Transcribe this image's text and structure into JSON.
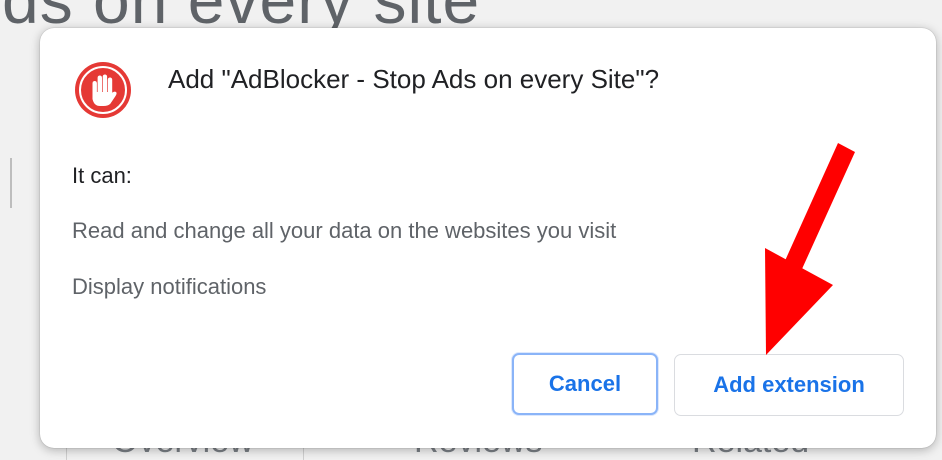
{
  "background": {
    "heading_fragment": "ds on every site",
    "tabs": [
      "Overview",
      "Reviews",
      "Related"
    ]
  },
  "dialog": {
    "icon": "adblocker-hand-icon",
    "icon_color": "#e53935",
    "title": "Add \"AdBlocker - Stop Ads on every Site\"?",
    "permissions_intro": "It can:",
    "permissions": [
      "Read and change all your data on the websites you visit",
      "Display notifications"
    ],
    "cancel_label": "Cancel",
    "add_label": "Add extension"
  },
  "annotation": {
    "type": "arrow",
    "color": "#ff0000",
    "points_to": "add-extension-button"
  },
  "colors": {
    "accent": "#1a73e8",
    "title_text": "#202124",
    "secondary_text": "#5f6368"
  }
}
